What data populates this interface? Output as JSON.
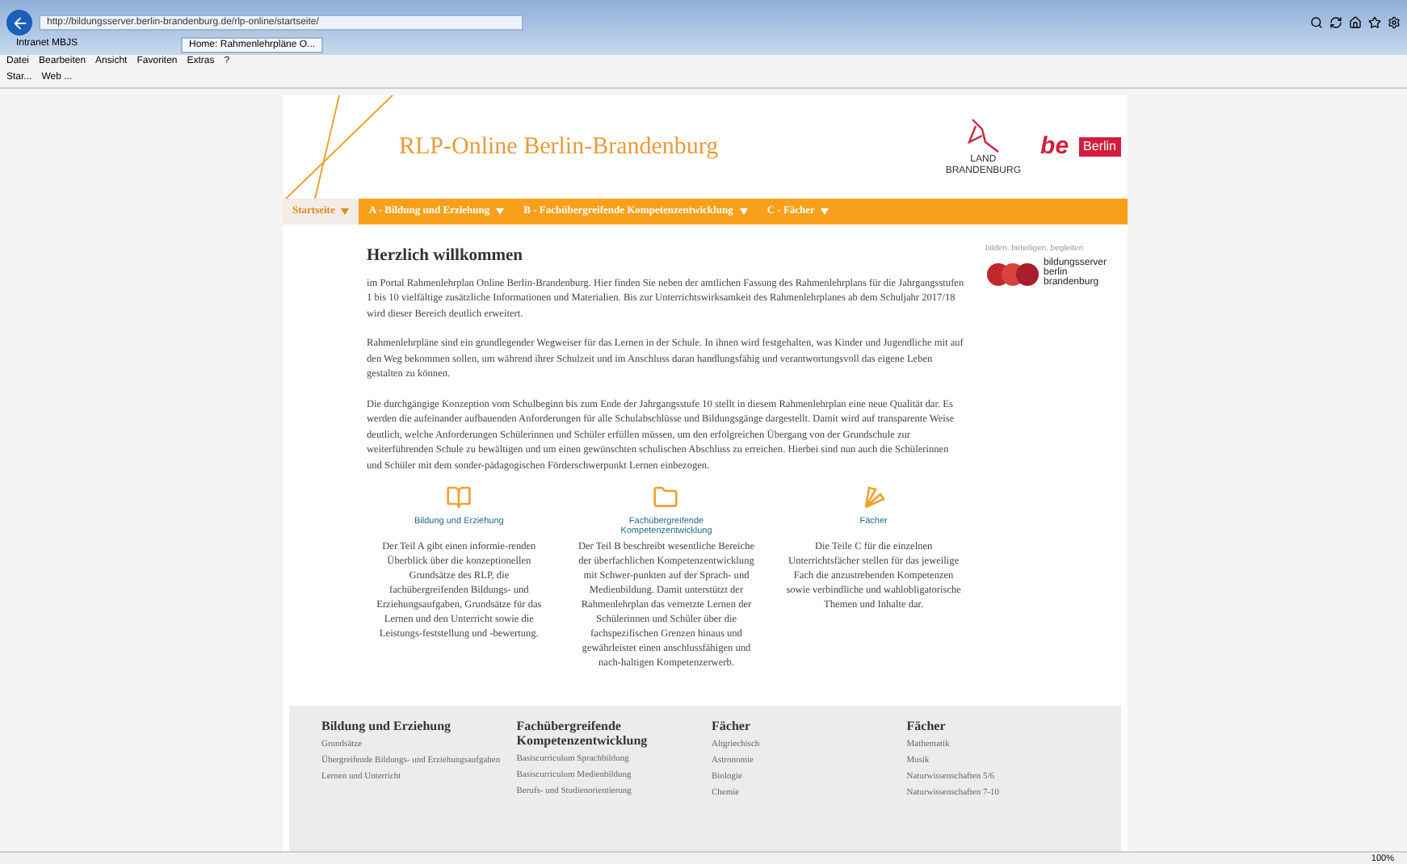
{
  "browser": {
    "address": "http://bildungsserver.berlin-brandenburg.de/rlp-online/startseite/",
    "tabs": [
      {
        "label": "Intranet MBJS",
        "selected": false
      },
      {
        "label": "Home: Rahmenlehrpläne O...",
        "selected": true
      }
    ],
    "menu": [
      "Datei",
      "Bearbeiten",
      "Ansicht",
      "Favoriten",
      "Extras",
      "?"
    ],
    "favorites": [
      "Star...",
      "Web ..."
    ],
    "zoom": "100%"
  },
  "header": {
    "title": "RLP-Online Berlin-Brandenburg",
    "logo_brandenburg": [
      "LAND",
      "BRANDENBURG"
    ],
    "logo_berlin": {
      "prefix": "be",
      "name": "Berlin"
    }
  },
  "nav": [
    {
      "label": "Startseite",
      "selected": true
    },
    {
      "label": "A - Bildung und Erziehung",
      "selected": false
    },
    {
      "label": "B - Fachübergreifende Kompetenzentwicklung",
      "selected": false
    },
    {
      "label": "C - Fächer",
      "selected": false
    }
  ],
  "sidebar": {
    "tagline": "bilden. beteiligen. begleiten",
    "logo_text": [
      "bildungsserver",
      "berlin",
      "brandenburg"
    ]
  },
  "welcome": {
    "title": "Herzlich willkommen",
    "paragraphs": [
      "im Portal Rahmenlehrplan Online Berlin-Brandenburg. Hier finden Sie neben der amtlichen Fassung des Rahmenlehrplans für die Jahrgangsstufen 1 bis 10 vielfältige zusätzliche Informationen und Materialien. Bis zur Unterrichtswirksamkeit des Rahmenlehrplanes ab dem Schuljahr 2017/18 wird dieser Bereich deutlich erweitert.",
      "Rahmenlehrpläne sind ein grundlegender Wegweiser für das Lernen in der Schule. In ihnen wird festgehalten, was Kinder und Jugendliche mit auf den Weg bekommen sollen, um während ihrer Schulzeit und im Anschluss daran handlungsfähig und verantwortungsvoll das eigene Leben gestalten zu können.",
      "Die durchgängige Konzeption vom Schulbeginn bis zum Ende der Jahrgangsstufe 10 stellt in diesem Rahmenlehrplan eine neue Qualität dar. Es werden die aufeinander aufbauenden Anforderungen für alle Schulabschlüsse und Bildungsgänge dargestellt. Damit wird auf transparente Weise deutlich, welche Anforderungen Schülerinnen und Schüler erfüllen müssen, um den erfolgreichen Übergang von der Grundschule zur weiterführenden Schule zu bewältigen und um einen gewünschten schulischen Abschluss zu erreichen. Hierbei sind nun auch die Schülerinnen und Schüler mit dem sonder-pädagogischen Förderschwerpunkt Lernen einbezogen."
    ]
  },
  "sections": [
    {
      "kind": "book",
      "title": "Bildung und Erziehung",
      "text": "Der Teil A gibt einen informie-renden Überblick über die konzeptionellen Grundsätze des RLP, die fachübergreifenden Bildungs- und Erziehungsaufgaben, Grundsätze für das Lernen und den Unterricht sowie die Leistungs-feststellung und -bewertung."
    },
    {
      "kind": "folder",
      "title": "Fachübergreifende Kompetenzentwicklung",
      "text": "Der Teil B beschreibt wesentliche Bereiche der überfachlichen Kompetenzentwicklung mit Schwer-punkten auf der Sprach- und Medienbildung. Damit unterstützt der Rahmenlehrplan das vernetzte Lernen der Schülerinnen und Schüler über die fachspezifischen Grenzen hinaus und gewährleistet einen anschlussfähigen und nach-haltigen Kompetenzerwerb."
    },
    {
      "kind": "fan",
      "title": "Fächer",
      "text": "Die Teile C für die einzelnen Unterrichtsfächer stellen für das jeweilige Fach die anzustrebenden Kompetenzen sowie verbindliche und wahlobligatorische Themen und Inhalte dar."
    }
  ],
  "footer": [
    {
      "title": "Bildung und Erziehung",
      "links": [
        "Grundsätze",
        "Übergreifende Bildungs- und Erziehungsaufgaben",
        "Lernen und Unterricht"
      ]
    },
    {
      "title": "Fachübergreifende Kompetenzentwicklung",
      "links": [
        "Basiscurriculum Sprachbildung",
        "Basiscurriculum Medienbildung",
        "Berufs- und Studienorientierung"
      ]
    },
    {
      "title": "Fächer",
      "links": [
        "Altgriechisch",
        "Astronomie",
        "Biologie",
        "Chemie"
      ]
    },
    {
      "title": "Fächer",
      "links": [
        "Mathematik",
        "Musik",
        "Naturwissenschaften 5/6",
        "Naturwissenschaften 7-10"
      ]
    }
  ]
}
